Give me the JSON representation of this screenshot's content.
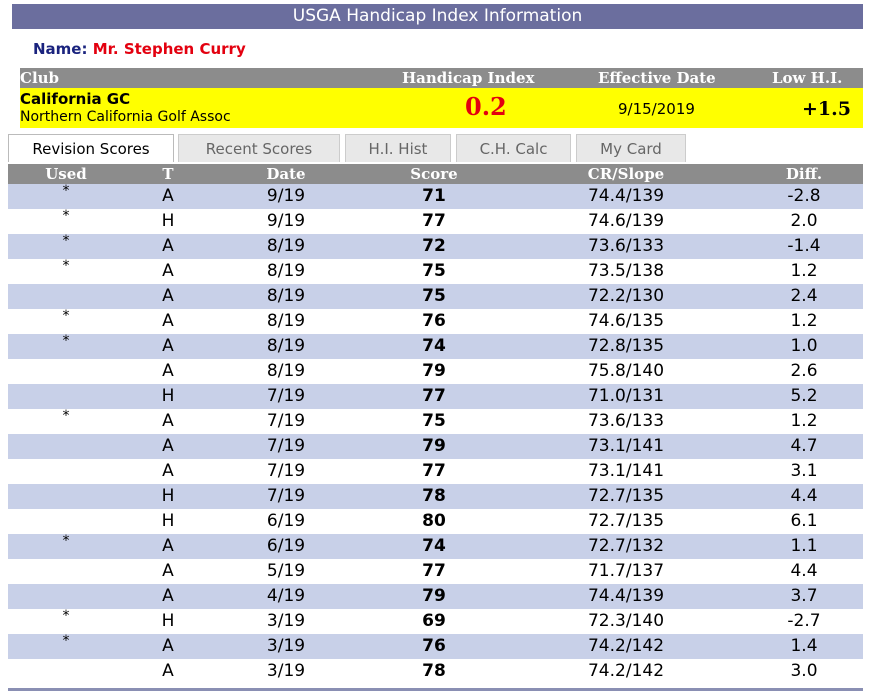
{
  "header": {
    "title": "USGA Handicap Index Information"
  },
  "player": {
    "name_label": "Name:",
    "name": "Mr. Stephen Curry"
  },
  "club_header": {
    "club": "Club",
    "handicap_index": "Handicap Index",
    "effective_date": "Effective Date",
    "low_hi": "Low H.I."
  },
  "club_info": {
    "club_name": "California GC",
    "association": "Northern California Golf Assoc",
    "handicap_index": "0.2",
    "effective_date": "9/15/2019",
    "low_hi": "+1.5"
  },
  "tabs": [
    {
      "label": "Revision Scores",
      "active": true
    },
    {
      "label": "Recent Scores",
      "active": false
    },
    {
      "label": "H.I. Hist",
      "active": false
    },
    {
      "label": "C.H. Calc",
      "active": false
    },
    {
      "label": "My Card",
      "active": false
    }
  ],
  "columns": [
    "Used",
    "T",
    "Date",
    "Score",
    "CR/Slope",
    "Diff."
  ],
  "rows": [
    {
      "used": "*",
      "t": "A",
      "date": "9/19",
      "score": "71",
      "cr_slope": "74.4/139",
      "diff": "-2.8"
    },
    {
      "used": "*",
      "t": "H",
      "date": "9/19",
      "score": "77",
      "cr_slope": "74.6/139",
      "diff": "2.0"
    },
    {
      "used": "*",
      "t": "A",
      "date": "8/19",
      "score": "72",
      "cr_slope": "73.6/133",
      "diff": "-1.4"
    },
    {
      "used": "*",
      "t": "A",
      "date": "8/19",
      "score": "75",
      "cr_slope": "73.5/138",
      "diff": "1.2"
    },
    {
      "used": "",
      "t": "A",
      "date": "8/19",
      "score": "75",
      "cr_slope": "72.2/130",
      "diff": "2.4"
    },
    {
      "used": "*",
      "t": "A",
      "date": "8/19",
      "score": "76",
      "cr_slope": "74.6/135",
      "diff": "1.2"
    },
    {
      "used": "*",
      "t": "A",
      "date": "8/19",
      "score": "74",
      "cr_slope": "72.8/135",
      "diff": "1.0"
    },
    {
      "used": "",
      "t": "A",
      "date": "8/19",
      "score": "79",
      "cr_slope": "75.8/140",
      "diff": "2.6"
    },
    {
      "used": "",
      "t": "H",
      "date": "7/19",
      "score": "77",
      "cr_slope": "71.0/131",
      "diff": "5.2"
    },
    {
      "used": "*",
      "t": "A",
      "date": "7/19",
      "score": "75",
      "cr_slope": "73.6/133",
      "diff": "1.2"
    },
    {
      "used": "",
      "t": "A",
      "date": "7/19",
      "score": "79",
      "cr_slope": "73.1/141",
      "diff": "4.7"
    },
    {
      "used": "",
      "t": "A",
      "date": "7/19",
      "score": "77",
      "cr_slope": "73.1/141",
      "diff": "3.1"
    },
    {
      "used": "",
      "t": "H",
      "date": "7/19",
      "score": "78",
      "cr_slope": "72.7/135",
      "diff": "4.4"
    },
    {
      "used": "",
      "t": "H",
      "date": "6/19",
      "score": "80",
      "cr_slope": "72.7/135",
      "diff": "6.1"
    },
    {
      "used": "*",
      "t": "A",
      "date": "6/19",
      "score": "74",
      "cr_slope": "72.7/132",
      "diff": "1.1"
    },
    {
      "used": "",
      "t": "A",
      "date": "5/19",
      "score": "77",
      "cr_slope": "71.7/137",
      "diff": "4.4"
    },
    {
      "used": "",
      "t": "A",
      "date": "4/19",
      "score": "79",
      "cr_slope": "74.4/139",
      "diff": "3.7"
    },
    {
      "used": "*",
      "t": "H",
      "date": "3/19",
      "score": "69",
      "cr_slope": "72.3/140",
      "diff": "-2.7"
    },
    {
      "used": "*",
      "t": "A",
      "date": "3/19",
      "score": "76",
      "cr_slope": "74.2/142",
      "diff": "1.4"
    },
    {
      "used": "",
      "t": "A",
      "date": "3/19",
      "score": "78",
      "cr_slope": "74.2/142",
      "diff": "3.0"
    }
  ],
  "colors": {
    "title_bar": "#6b6e9e",
    "header_gray": "#8c8c8c",
    "highlight_yellow": "#ffff00",
    "row_alt": "#c8d0e8",
    "accent_red": "#e3000f",
    "name_label": "#1a237e"
  }
}
